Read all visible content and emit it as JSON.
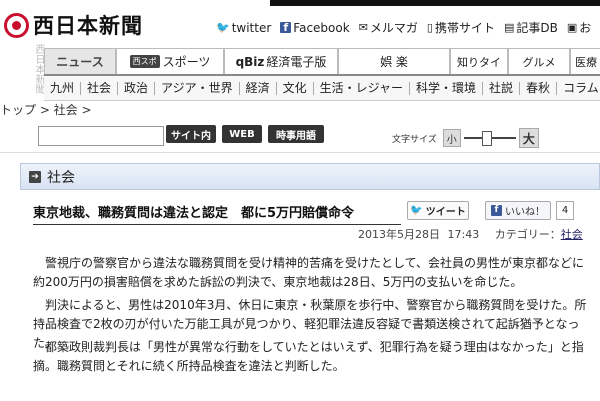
{
  "brand": {
    "name": "西日本新聞",
    "stamp": "西日本新聞"
  },
  "top_links": [
    {
      "icon": "twitter-icon",
      "glyph": "🐦",
      "label": "twitter"
    },
    {
      "icon": "facebook-icon",
      "glyph": "f",
      "label": "Facebook"
    },
    {
      "icon": "mail-icon",
      "glyph": "✉",
      "label": "メルマガ"
    },
    {
      "icon": "mobile-icon",
      "glyph": "▯",
      "label": "携帯サイト"
    },
    {
      "icon": "db-icon",
      "glyph": "▤",
      "label": "記事DB"
    },
    {
      "icon": "bookmark-icon",
      "glyph": "▣",
      "label": "お"
    }
  ],
  "nav_tabs": {
    "news": "ニュース",
    "sports_badge": "西スポ",
    "sports": "スポーツ",
    "biz_badge": "qBiz",
    "biz": "経済電子版",
    "entertainment": "娯 楽",
    "chishiki": "知りタイ",
    "gourmet": "グルメ",
    "iryo": "医療"
  },
  "categories": [
    "九州",
    "社会",
    "政治",
    "アジア・世界",
    "経済",
    "文化",
    "生活・レジャー",
    "科学・環境",
    "社説",
    "春秋",
    "コラム"
  ],
  "breadcrumb": "トップ > 社会 >",
  "search": {
    "placeholder": "",
    "site_button": "サイト内",
    "web_button": "WEB",
    "terms_button": "時事用語"
  },
  "font_size": {
    "label": "文字サイズ",
    "small": "小",
    "large": "大"
  },
  "section": {
    "title": "社会"
  },
  "article": {
    "headline": "東京地裁、職務質問は違法と認定　都に5万円賠償命令",
    "tweet_label": "ツイート",
    "like_label": "いいね！",
    "like_count": "4",
    "date": "2013年5月28日",
    "time": "17:43",
    "category_label": "カテゴリー：",
    "category": "社会",
    "paragraphs": [
      "警視庁の警察官から違法な職務質問を受け精神的苦痛を受けたとして、会社員の男性が東京都などに約200万円の損害賠償を求めた訴訟の判決で、東京地裁は28日、5万円の支払いを命じた。",
      "判決によると、男性は2010年3月、休日に東京・秋葉原を歩行中、警察官から職務質問を受けた。所持品検査で2枚の刃が付いた万能工具が見つかり、軽犯罪法違反容疑で書類送検されて起訴猶予となった。",
      "都築政則裁判長は「男性が異常な行動をしていたとはいえず、犯罪行為を疑う理由はなかった」と指摘。職務質問とそれに続く所持品検査を違法と判断した。"
    ]
  },
  "colors": {
    "brand_red": "#c8102e",
    "section_blue": "#d8e3f3"
  }
}
